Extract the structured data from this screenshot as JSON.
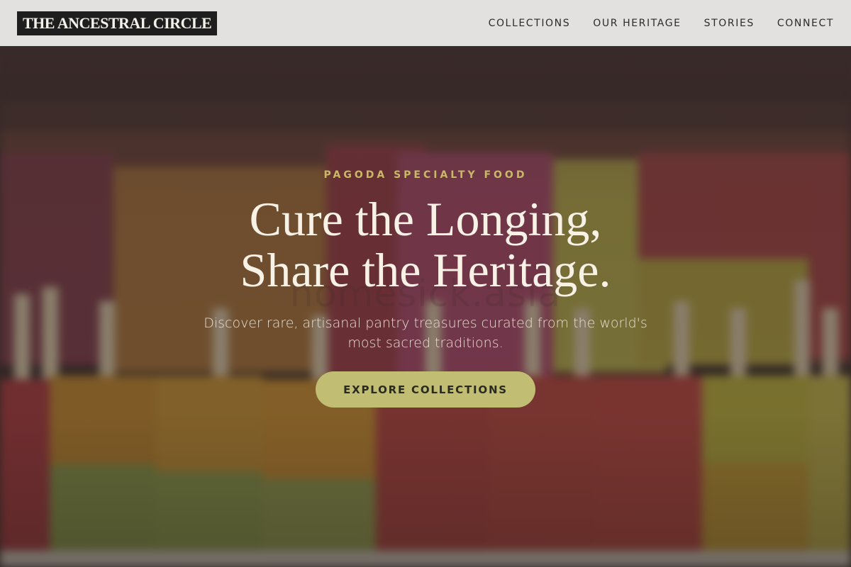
{
  "brand": {
    "logo_text": "THE ANCESTRAL CIRCLE"
  },
  "nav": {
    "items": [
      {
        "label": "COLLECTIONS"
      },
      {
        "label": "OUR HERITAGE"
      },
      {
        "label": "STORIES"
      },
      {
        "label": "CONNECT"
      }
    ]
  },
  "hero": {
    "eyebrow": "PAGODA SPECIALTY FOOD",
    "headline_line1": "Cure the Longing,",
    "headline_line2": "Share the Heritage.",
    "subhead": "Discover rare, artisanal pantry treasures curated from the world's most sacred traditions.",
    "cta_label": "EXPLORE COLLECTIONS",
    "watermark": "homesick.asia"
  },
  "colors": {
    "header_bg": "#e3e1df",
    "logo_bg": "#1e1e1e",
    "accent_gold": "#c9b866",
    "cta_bg": "#c1bd72",
    "headline_text": "#f7f1e6"
  }
}
